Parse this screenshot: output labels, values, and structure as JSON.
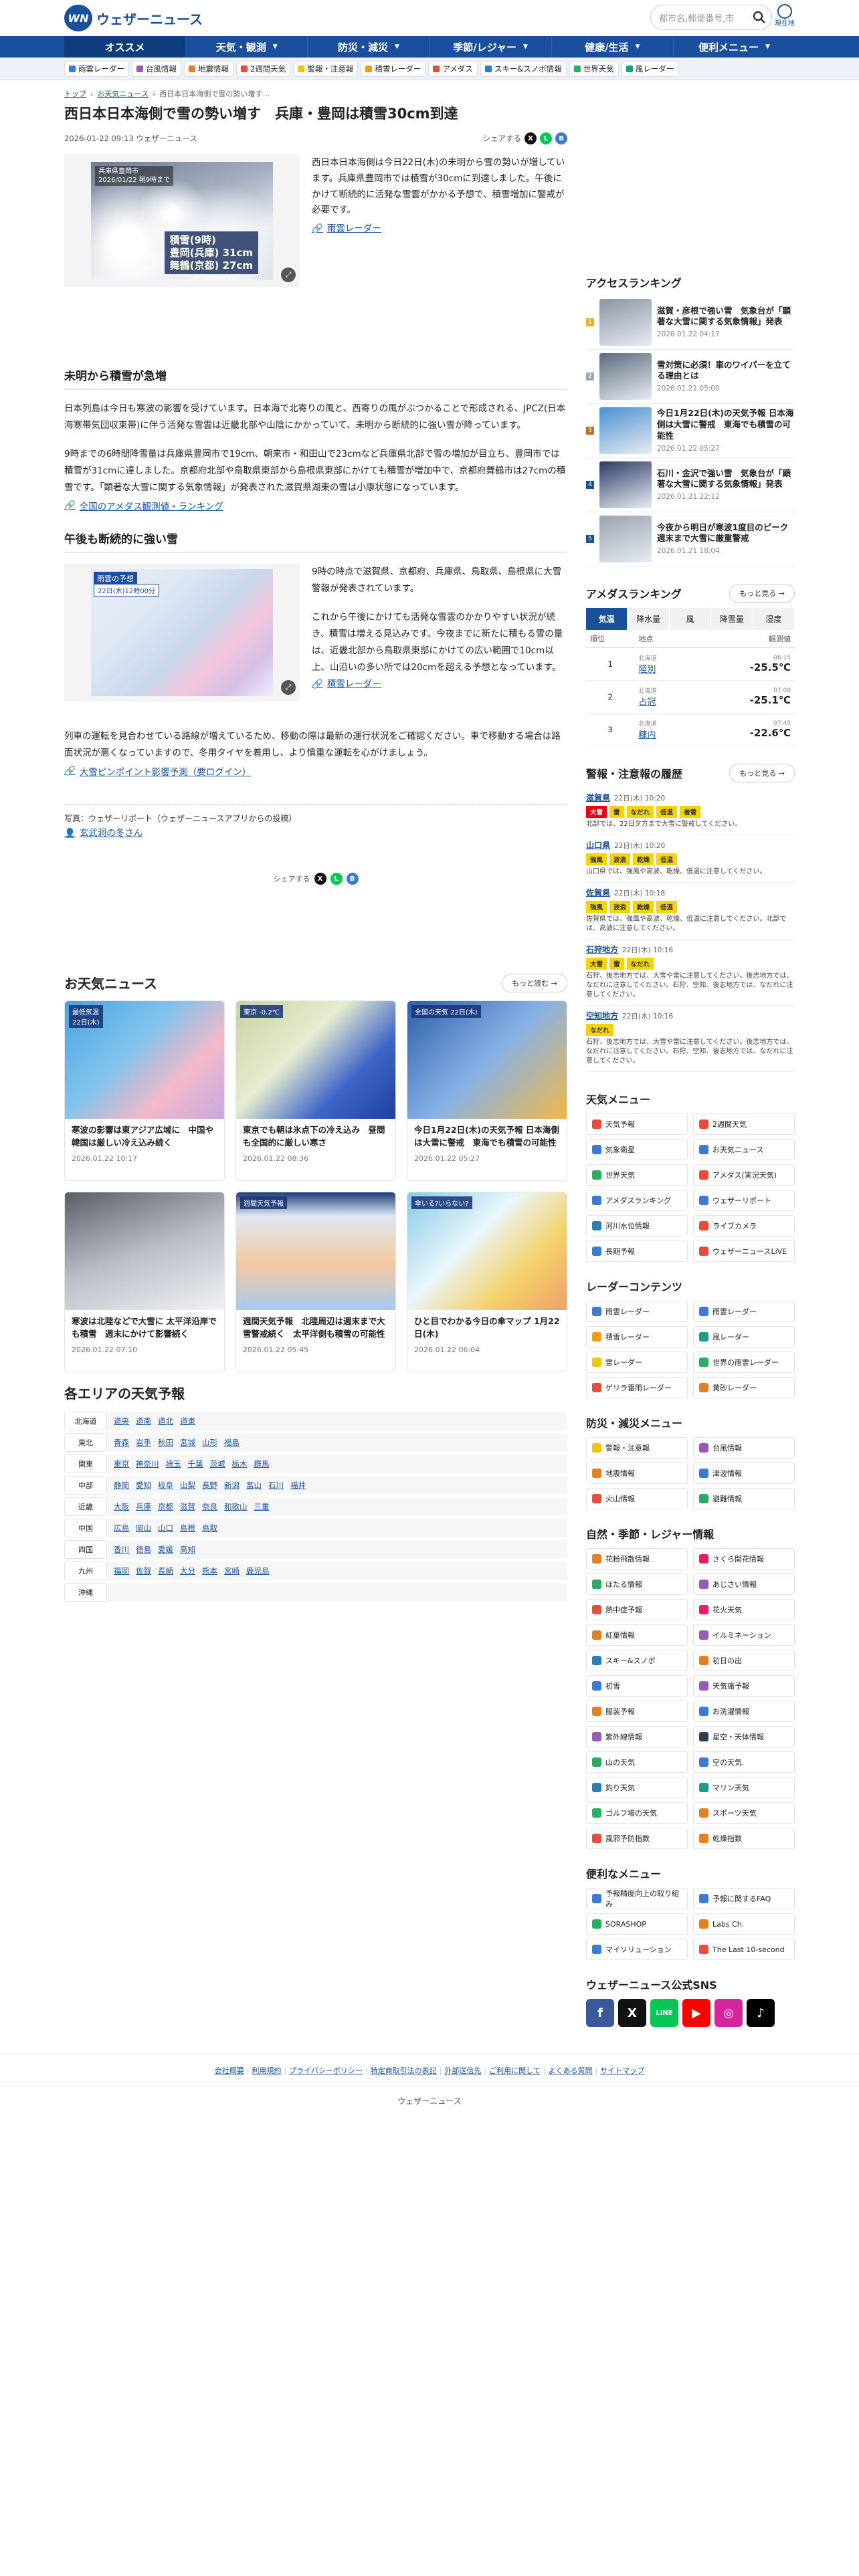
{
  "header": {
    "logo_mark": "WN",
    "logo_text": "ウェザーニュース",
    "search_placeholder": "都市名,郵便番号,市",
    "location_label": "現在地"
  },
  "gnav": [
    "オススメ",
    "天気・観測",
    "防災・減災",
    "季節/レジャー",
    "健康/生活",
    "便利メニュー"
  ],
  "quicklinks": [
    {
      "label": "雨雲レーダー",
      "color": "#3a7bd5"
    },
    {
      "label": "台風情報",
      "color": "#9b59b6"
    },
    {
      "label": "地震情報",
      "color": "#e67e22"
    },
    {
      "label": "2週間天気",
      "color": "#e74c3c"
    },
    {
      "label": "警報・注意報",
      "color": "#f1c40f"
    },
    {
      "label": "積雪レーダー",
      "color": "#f39c12"
    },
    {
      "label": "アメダス",
      "color": "#e74c3c"
    },
    {
      "label": "スキー&スノボ情報",
      "color": "#2980b9"
    },
    {
      "label": "世界天気",
      "color": "#27ae60"
    },
    {
      "label": "風レーダー",
      "color": "#16a085"
    }
  ],
  "breadcrumb": [
    "トップ",
    "お天気ニュース",
    "西日本日本海側で雪の勢い増す…"
  ],
  "article": {
    "title": "西日本日本海側で雪の勢い増す　兵庫・豊岡は積雪30cm到達",
    "date": "2026-01-22 09:13 ウェザーニュース",
    "share_label": "シェアする",
    "fig1_badge": "兵庫県豊岡市\n2026/01/22 朝9時まで",
    "fig1_overlay": "積雪(9時)\n豊岡(兵庫) 31cm\n舞鶴(京都) 27cm",
    "lead": "西日本日本海側は今日22日(木)の未明から雪の勢いが増しています。兵庫県豊岡市では積雪が30cmに到達しました。午後にかけて断続的に活発な雪雲がかかる予想で、積雪増加に警戒が必要です。",
    "lead_link": "雨雲レーダー",
    "h2_1": "未明から積雪が急増",
    "p1": "日本列島は今日も寒波の影響を受けています。日本海で北寄りの風と、西寄りの風がぶつかることで形成される、JPCZ(日本海寒帯気団収束帯)に伴う活発な雪雲は近畿北部や山陰にかかっていて、未明から断続的に強い雪が降っています。",
    "p2": "9時までの6時間降雪量は兵庫県豊岡市で19cm、朝来市・和田山で23cmなど兵庫県北部で雪の増加が目立ち、豊岡市では積雪が31cmに達しました。京都府北部や鳥取県東部から島根県東部にかけても積雪が増加中で、京都府舞鶴市は27cmの積雪です。「顕著な大雪に関する気象情報」が発表された滋賀県湖東の雪は小康状態になっています。",
    "link1": "全国のアメダス観測値・ランキング",
    "h2_2": "午後も断続的に強い雪",
    "fig2_badge": "雨雲の予想",
    "fig2_time": "22日(木)12時00分",
    "p3": "9時の時点で滋賀県、京都府、兵庫県、鳥取県、島根県に大雪警報が発表されています。",
    "p4": "これから午後にかけても活発な雪雲のかかりやすい状況が続き、積雪は増える見込みです。今夜までに新たに積もる雪の量は、近畿北部から鳥取県東部にかけての広い範囲で10cm以上、山沿いの多い所では20cmを超える予想となっています。",
    "link2": "積雪レーダー",
    "p5": "列車の運転を見合わせている路線が増えているため、移動の際は最新の運行状況をご確認ください。車で移動する場合は路面状況が悪くなっていますので、冬用タイヤを着用し、より慎重な運転を心がけましょう。",
    "link3": "大雪ピンポイント影響予測（要ログイン）",
    "photo_credit": "写真：ウェザーリポート（ウェザーニュースアプリからの投稿）",
    "photo_user": "玄武洞の冬さん"
  },
  "news": {
    "title": "お天気ニュース",
    "more": "もっと読む",
    "items": [
      {
        "title": "寒波の影響は東アジア広域に　中国や韓国は厳しい冷え込み続く",
        "date": "2026.01.22 10:17",
        "thumb_label": "最低気温\n22日(木)"
      },
      {
        "title": "東京でも朝は氷点下の冷え込み　昼間も全国的に厳しい寒さ",
        "date": "2026.01.22 08:36",
        "thumb_label": "東京 -0.2℃"
      },
      {
        "title": "今日1月22日(木)の天気予報 日本海側は大雪に警戒　東海でも積雪の可能性",
        "date": "2026.01.22 05:27",
        "thumb_label": "全国の天気 22日(木)"
      },
      {
        "title": "寒波は北陸などで大雪に 太平洋沿岸でも積雪　週末にかけて影響続く",
        "date": "2026.01.22 07:10",
        "thumb_label": ""
      },
      {
        "title": "週間天気予報　北陸周辺は週末まで大雪警戒続く　太平洋側も積雪の可能性",
        "date": "2026.01.22 05:45",
        "thumb_label": "週間天気予報"
      },
      {
        "title": "ひと目でわかる今日の傘マップ 1月22日(木)",
        "date": "2026.01.22 06:04",
        "thumb_label": "傘いる?いらない?"
      }
    ]
  },
  "areas": {
    "title": "各エリアの天気予報",
    "rows": [
      {
        "region": "北海道",
        "prefs": [
          "道央",
          "道南",
          "道北",
          "道東"
        ]
      },
      {
        "region": "東北",
        "prefs": [
          "青森",
          "岩手",
          "秋田",
          "宮城",
          "山形",
          "福島"
        ]
      },
      {
        "region": "関東",
        "prefs": [
          "東京",
          "神奈川",
          "埼玉",
          "千葉",
          "茨城",
          "栃木",
          "群馬"
        ]
      },
      {
        "region": "中部",
        "prefs": [
          "静岡",
          "愛知",
          "岐阜",
          "山梨",
          "長野",
          "新潟",
          "富山",
          "石川",
          "福井"
        ]
      },
      {
        "region": "近畿",
        "prefs": [
          "大阪",
          "兵庫",
          "京都",
          "滋賀",
          "奈良",
          "和歌山",
          "三重"
        ]
      },
      {
        "region": "中国",
        "prefs": [
          "広島",
          "岡山",
          "山口",
          "島根",
          "鳥取"
        ]
      },
      {
        "region": "四国",
        "prefs": [
          "香川",
          "徳島",
          "愛媛",
          "高知"
        ]
      },
      {
        "region": "九州",
        "prefs": [
          "福岡",
          "佐賀",
          "長崎",
          "大分",
          "熊本",
          "宮崎",
          "鹿児島"
        ]
      },
      {
        "region": "沖縄",
        "prefs": []
      }
    ]
  },
  "access_ranking": {
    "title": "アクセスランキング",
    "items": [
      {
        "title": "滋賀・彦根で強い雪　気象台が「顕著な大雪に関する気象情報」発表",
        "date": "2026.01.22 04:17",
        "color": "#8a94a3"
      },
      {
        "title": "雪対策に必須！車のワイパーを立てる理由とは",
        "date": "2026.01.21 05:00",
        "color": "#5d6a7c"
      },
      {
        "title": "今日1月22日(木)の天気予報 日本海側は大雪に警戒　東海でも積雪の可能性",
        "date": "2026.01.22 05:27",
        "color": "#4a8fd2"
      },
      {
        "title": "石川・金沢で強い雪　気象台が「顕著な大雪に関する気象情報」発表",
        "date": "2026.01.21 22:12",
        "color": "#2d3c66"
      },
      {
        "title": "今夜から明日が寒波1度目のピーク　週末まで大雪に厳重警戒",
        "date": "2026.01.21 18:04",
        "color": "#9aa3b0"
      }
    ]
  },
  "amedas": {
    "title": "アメダスランキング",
    "more": "もっと見る",
    "tabs": [
      "気温",
      "降水量",
      "風",
      "降雪量",
      "湿度"
    ],
    "head": [
      "順位",
      "地点",
      "観測値"
    ],
    "rows": [
      {
        "rank": "1",
        "pref": "北海道",
        "name": "陸別",
        "time": "06:15",
        "value": "-25.5℃"
      },
      {
        "rank": "2",
        "pref": "北海道",
        "name": "占冠",
        "time": "07:08",
        "value": "-25.1℃"
      },
      {
        "rank": "3",
        "pref": "北海道",
        "name": "糠内",
        "time": "07:45",
        "value": "-22.6℃"
      }
    ]
  },
  "warnings": {
    "title": "警報・注意報の履歴",
    "more": "もっと見る",
    "items": [
      {
        "area": "滋賀県",
        "time": "22日(木) 10:20",
        "tags": [
          [
            "大雪",
            "r"
          ],
          [
            "雷",
            "y"
          ],
          [
            "なだれ",
            "y"
          ],
          [
            "低温",
            "y"
          ],
          [
            "着雪",
            "y"
          ]
        ],
        "desc": "北部では、22日夕方まで大雪に警戒してください。"
      },
      {
        "area": "山口県",
        "time": "22日(木) 10:20",
        "tags": [
          [
            "強風",
            "y"
          ],
          [
            "波浪",
            "y"
          ],
          [
            "乾燥",
            "y"
          ],
          [
            "低温",
            "y"
          ]
        ],
        "desc": "山口県では、強風や高波、乾燥、低温に注意してください。"
      },
      {
        "area": "佐賀県",
        "time": "22日(木) 10:18",
        "tags": [
          [
            "強風",
            "y"
          ],
          [
            "波浪",
            "y"
          ],
          [
            "乾燥",
            "y"
          ],
          [
            "低温",
            "y"
          ]
        ],
        "desc": "佐賀県では、強風や高波、乾燥、低温に注意してください。北部では、高波に注意してください。"
      },
      {
        "area": "石狩地方",
        "time": "22日(木) 10:16",
        "tags": [
          [
            "大雪",
            "y"
          ],
          [
            "雷",
            "y"
          ],
          [
            "なだれ",
            "y"
          ]
        ],
        "desc": "石狩、後志地方では、大雪や雷に注意してください。後志地方では、なだれに注意してください。石狩、空知、後志地方では、なだれに注意してください。"
      },
      {
        "area": "空知地方",
        "time": "22日(木) 10:16",
        "tags": [
          [
            "なだれ",
            "y"
          ]
        ],
        "desc": "石狩、後志地方では、大雪や雷に注意してください。後志地方では、なだれに注意してください。石狩、空知、後志地方では、なだれに注意してください。"
      }
    ]
  },
  "side_menus": [
    {
      "title": "天気メニュー",
      "items": [
        [
          "天気予報",
          "#e74c3c"
        ],
        [
          "2週間天気",
          "#e74c3c"
        ],
        [
          "気象衛星",
          "#3a7bd5"
        ],
        [
          "お天気ニュース",
          "#3a7bd5"
        ],
        [
          "世界天気",
          "#27ae60"
        ],
        [
          "アメダス(実況天気)",
          "#e74c3c"
        ],
        [
          "アメダスランキング",
          "#3a7bd5"
        ],
        [
          "ウェザーリポート",
          "#3a7bd5"
        ],
        [
          "河川水位情報",
          "#2980b9"
        ],
        [
          "ライブカメラ",
          "#e74c3c"
        ],
        [
          "長期予報",
          "#3a7bd5"
        ],
        [
          "ウェザーニュースLiVE",
          "#e74c3c"
        ]
      ]
    },
    {
      "title": "レーダーコンテンツ",
      "items": [
        [
          "雨雲レーダー",
          "#3a7bd5"
        ],
        [
          "雨雲レーダー",
          "#3a7bd5"
        ],
        [
          "積雪レーダー",
          "#f39c12"
        ],
        [
          "風レーダー",
          "#16a085"
        ],
        [
          "雷レーダー",
          "#f1c40f"
        ],
        [
          "世界の雨雲レーダー",
          "#27ae60"
        ],
        [
          "ゲリラ雷雨レーダー",
          "#e74c3c"
        ],
        [
          "黄砂レーダー",
          "#e67e22"
        ]
      ]
    },
    {
      "title": "防災・減災メニュー",
      "items": [
        [
          "警報・注意報",
          "#f1c40f"
        ],
        [
          "台風情報",
          "#9b59b6"
        ],
        [
          "地震情報",
          "#e67e22"
        ],
        [
          "津波情報",
          "#3a7bd5"
        ],
        [
          "火山情報",
          "#e74c3c"
        ],
        [
          "避難情報",
          "#27ae60"
        ]
      ]
    },
    {
      "title": "自然・季節・レジャー情報",
      "items": [
        [
          "花粉飛散情報",
          "#e67e22"
        ],
        [
          "さくら開花情報",
          "#e91e63"
        ],
        [
          "ほたる情報",
          "#27ae60"
        ],
        [
          "あじさい情報",
          "#9b59b6"
        ],
        [
          "熱中症予報",
          "#e74c3c"
        ],
        [
          "花火天気",
          "#e91e63"
        ],
        [
          "紅葉情報",
          "#e67e22"
        ],
        [
          "イルミネーション",
          "#9b59b6"
        ],
        [
          "スキー&スノボ",
          "#2980b9"
        ],
        [
          "初日の出",
          "#e67e22"
        ],
        [
          "初雪",
          "#3a7bd5"
        ],
        [
          "天気痛予報",
          "#9b59b6"
        ],
        [
          "服装予報",
          "#e67e22"
        ],
        [
          "お洗濯情報",
          "#3a7bd5"
        ],
        [
          "紫外線情報",
          "#9b59b6"
        ],
        [
          "星空・天体情報",
          "#2c3e50"
        ],
        [
          "山の天気",
          "#27ae60"
        ],
        [
          "空の天気",
          "#3a7bd5"
        ],
        [
          "釣り天気",
          "#2980b9"
        ],
        [
          "マリン天気",
          "#16a085"
        ],
        [
          "ゴルフ場の天気",
          "#27ae60"
        ],
        [
          "スポーツ天気",
          "#e67e22"
        ],
        [
          "風邪予防指数",
          "#e74c3c"
        ],
        [
          "乾燥指数",
          "#e67e22"
        ]
      ]
    },
    {
      "title": "便利なメニュー",
      "items": [
        [
          "予報精度向上の取り組み",
          "#3a7bd5"
        ],
        [
          "予報に関するFAQ",
          "#3a7bd5"
        ],
        [
          "SORASHOP",
          "#27ae60"
        ],
        [
          "Labs Ch.",
          "#e67e22"
        ],
        [
          "マイソリューション",
          "#3a7bd5"
        ],
        [
          "The Last 10-second",
          "#e74c3c"
        ]
      ]
    }
  ],
  "sns": {
    "title": "ウェザーニュース公式SNS",
    "items": [
      [
        "f",
        "#3b5998"
      ],
      [
        "X",
        "#111"
      ],
      [
        "LINE",
        "#06c755"
      ],
      [
        "▶",
        "#ff0000"
      ],
      [
        "◎",
        "#d6249f"
      ],
      [
        "♪",
        "#000"
      ]
    ]
  },
  "footer": {
    "links": [
      "会社概要",
      "利用規約",
      "プライバシーポリシー",
      "特定商取引法の表記",
      "外部送信先",
      "ご利用に関して",
      "よくある質問",
      "サイトマップ"
    ],
    "copyright": "ウェザーニュース"
  }
}
